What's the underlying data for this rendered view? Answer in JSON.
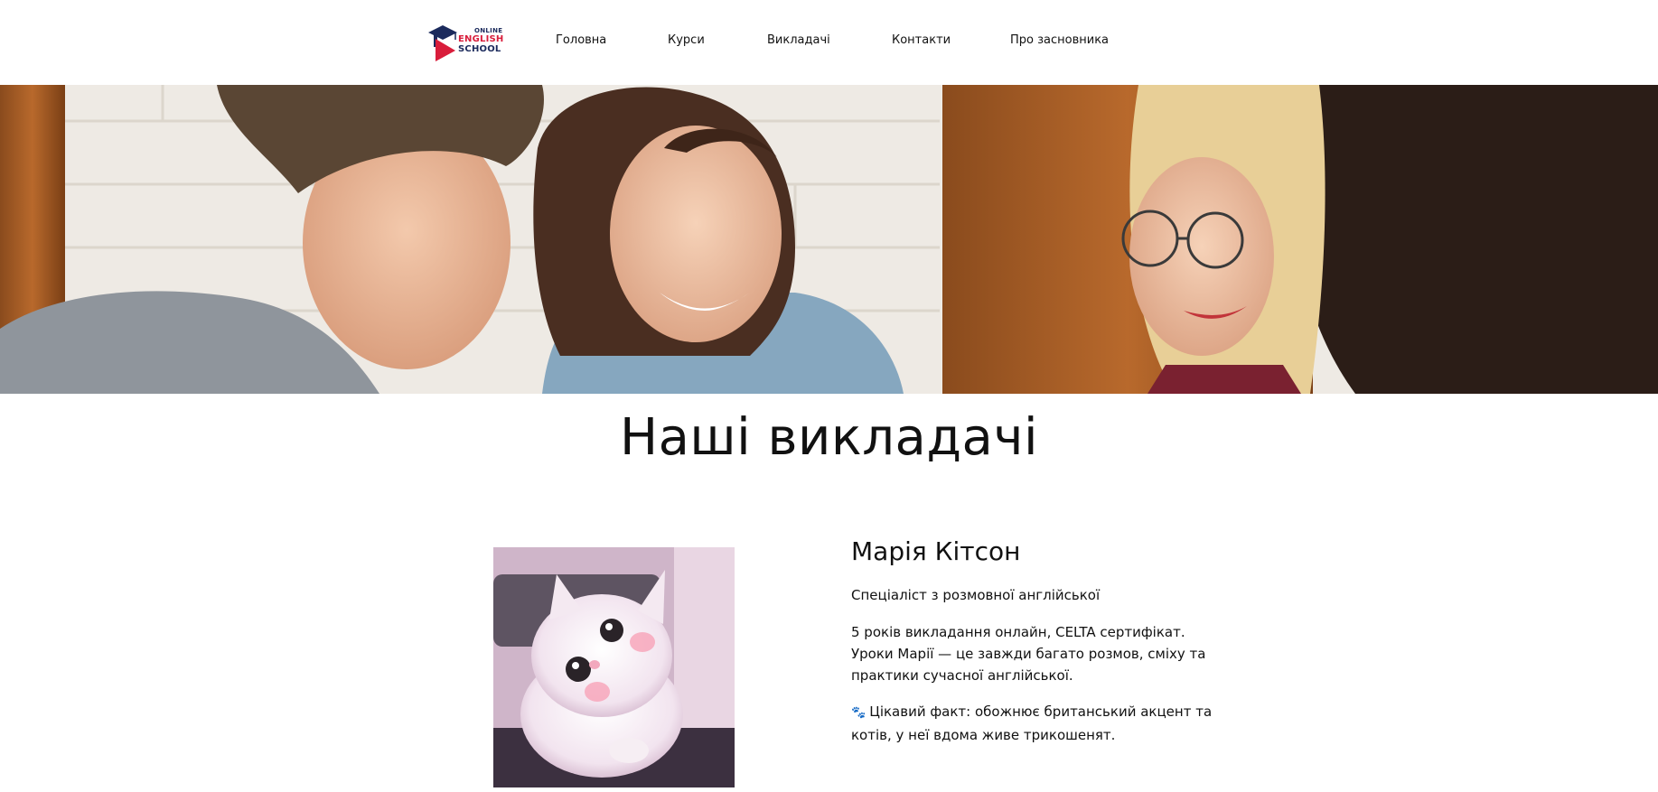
{
  "brand": {
    "logo_top": "ONLINE",
    "logo_mid": "ENGLISH",
    "logo_bottom": "SCHOOL",
    "colors": {
      "navy": "#1b2a5c",
      "red": "#d91d3b"
    }
  },
  "nav": {
    "items": [
      {
        "label": "Головна"
      },
      {
        "label": "Курси"
      },
      {
        "label": "Викладачі"
      },
      {
        "label": "Контакти"
      },
      {
        "label": "Про засновника"
      }
    ]
  },
  "main": {
    "title": "Наші викладачі",
    "teacher": {
      "name": "Марія Кітсон",
      "role": "Спеціаліст з розмовної англійської",
      "bio": "5 років викладання онлайн, CELTA сертифікат. Уроки Марії — це завжди багато розмов, сміху та практики сучасної англійської.",
      "fact_icon": "paw-icon",
      "fact": "Цікавий факт: обожнює британський акцент та котів, у неї вдома живе трикошенят."
    }
  }
}
